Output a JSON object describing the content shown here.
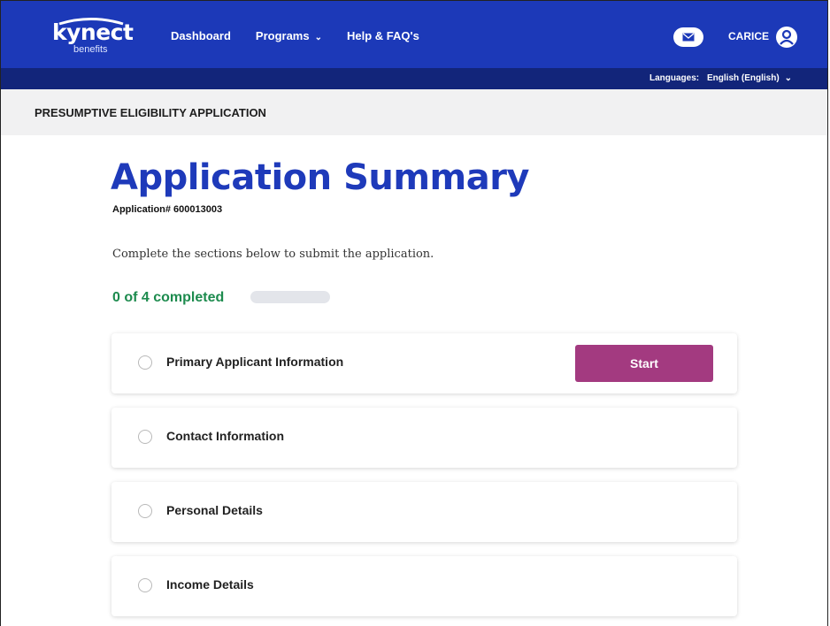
{
  "header": {
    "logo_text": "kynect",
    "logo_sub": "benefits",
    "nav": [
      "Dashboard",
      "Programs",
      "Help & FAQ's"
    ],
    "user_name": "CARICE"
  },
  "languages": {
    "label": "Languages:",
    "value": "English (English)"
  },
  "page_header": "PRESUMPTIVE ELIGIBILITY APPLICATION",
  "main": {
    "title": "Application Summary",
    "application_number": "Application# 600013003",
    "instructions": "Complete the sections below to submit the application.",
    "progress_text": "0 of 4 completed",
    "progress_fraction": 0,
    "sections": [
      {
        "label": "Primary Applicant Information",
        "action": "Start"
      },
      {
        "label": "Contact Information"
      },
      {
        "label": "Personal Details"
      },
      {
        "label": "Income Details"
      }
    ]
  },
  "colors": {
    "brand_blue": "#1c39b8",
    "dark_blue": "#12257a",
    "green": "#1d8b4e",
    "start_button": "#a33a80"
  }
}
